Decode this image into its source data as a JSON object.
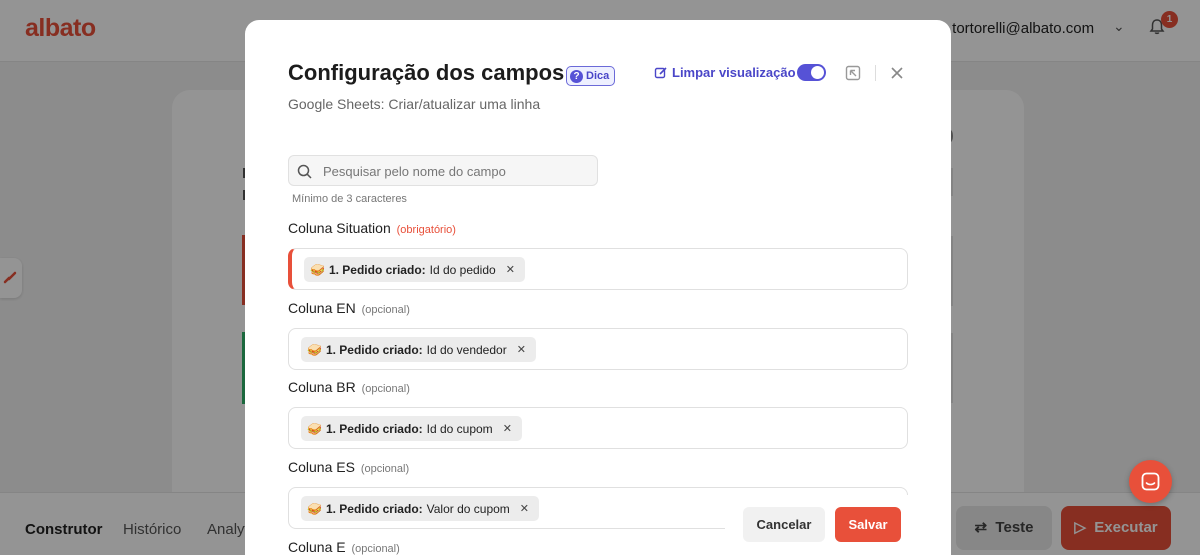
{
  "app": {
    "logo": "albato",
    "user_email": ".tortorelli@albato.com",
    "notifications_count": "1"
  },
  "bottom_bar": {
    "tabs": [
      {
        "label": "Construtor"
      },
      {
        "label": "Histórico"
      },
      {
        "label": "Analyt"
      }
    ],
    "test_label": "Teste",
    "run_label": "Executar"
  },
  "modal": {
    "title": "Configuração dos campos",
    "tip_label": "Dica",
    "subtitle": "Google Sheets: Criar/atualizar uma linha",
    "clear_view_label": "Limpar visualização",
    "clear_view_enabled": true,
    "search": {
      "placeholder": "Pesquisar pelo nome do campo",
      "value": "",
      "hint": "Mínimo de 3 caracteres"
    },
    "fields": [
      {
        "label": "Coluna Situation",
        "tag": "(obrigatório)",
        "required": true,
        "chip_step": "1. Pedido criado:",
        "chip_value": "Id do pedido"
      },
      {
        "label": "Coluna EN",
        "tag": "(opcional)",
        "required": false,
        "chip_step": "1. Pedido criado:",
        "chip_value": "Id do vendedor"
      },
      {
        "label": "Coluna BR",
        "tag": "(opcional)",
        "required": false,
        "chip_step": "1. Pedido criado:",
        "chip_value": "Id do cupom"
      },
      {
        "label": "Coluna ES",
        "tag": "(opcional)",
        "required": false,
        "chip_step": "1. Pedido criado:",
        "chip_value": "Valor do cupom"
      },
      {
        "label": "Coluna E",
        "tag": "(opcional)",
        "required": false
      }
    ],
    "cancel_label": "Cancelar",
    "save_label": "Salvar"
  },
  "colors": {
    "brand": "#e8503a",
    "accent": "#5652d6",
    "error": "#e8503a"
  }
}
